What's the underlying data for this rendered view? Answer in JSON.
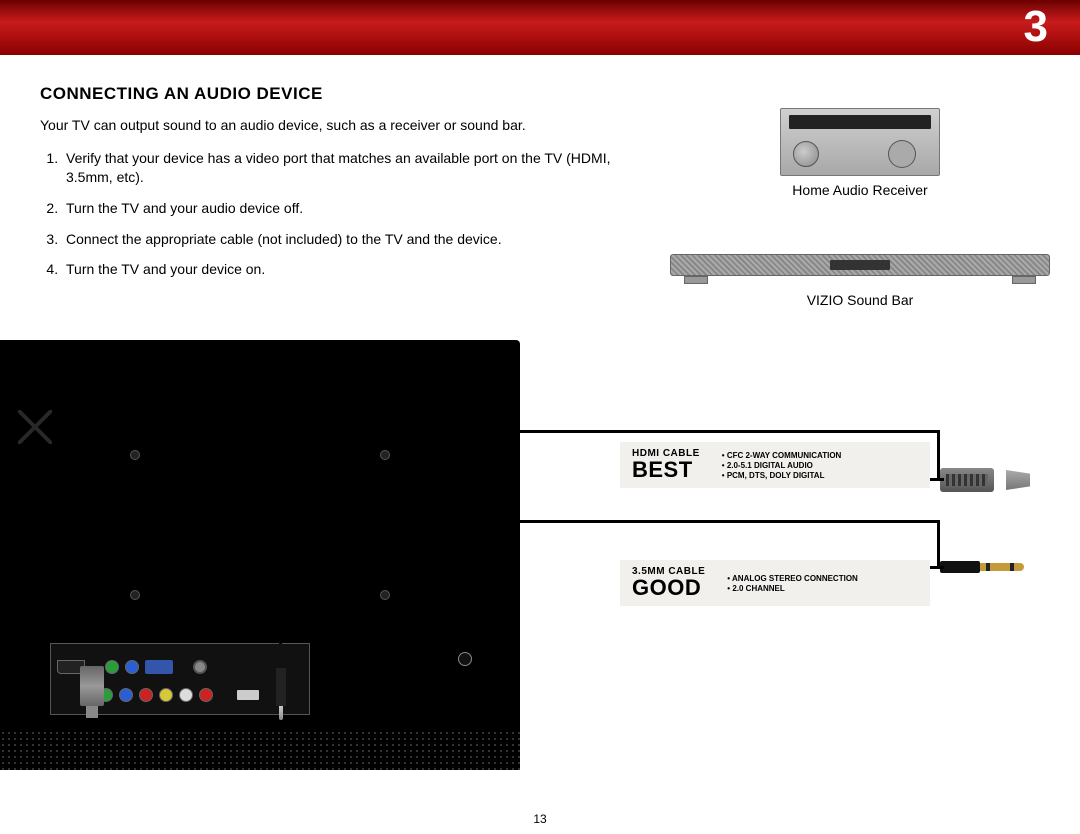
{
  "chapter": "3",
  "pageNumber": "13",
  "heading": "CONNECTING AN AUDIO DEVICE",
  "intro": "Your TV can output sound to an audio device, such as a receiver or sound bar.",
  "steps": [
    "Verify that your device has a video port that matches an available port on the TV (HDMI, 3.5mm, etc).",
    "Turn the TV and your audio device off.",
    "Connect the appropriate cable (not included) to the TV and the device.",
    "Turn the TV and your device on."
  ],
  "devices": {
    "receiver": "Home Audio Receiver",
    "soundbar": "VIZIO Sound Bar"
  },
  "cables": {
    "hdmi": {
      "title": "HDMI CABLE",
      "quality": "BEST",
      "features": [
        "CFC 2-WAY COMMUNICATION",
        "2.0-5.1 DIGITAL AUDIO",
        "PCM, DTS, DOLY DIGITAL"
      ]
    },
    "aux": {
      "title": "3.5MM CABLE",
      "quality": "GOOD",
      "features": [
        "ANALOG STEREO CONNECTION",
        "2.0 CHANNEL"
      ]
    }
  }
}
